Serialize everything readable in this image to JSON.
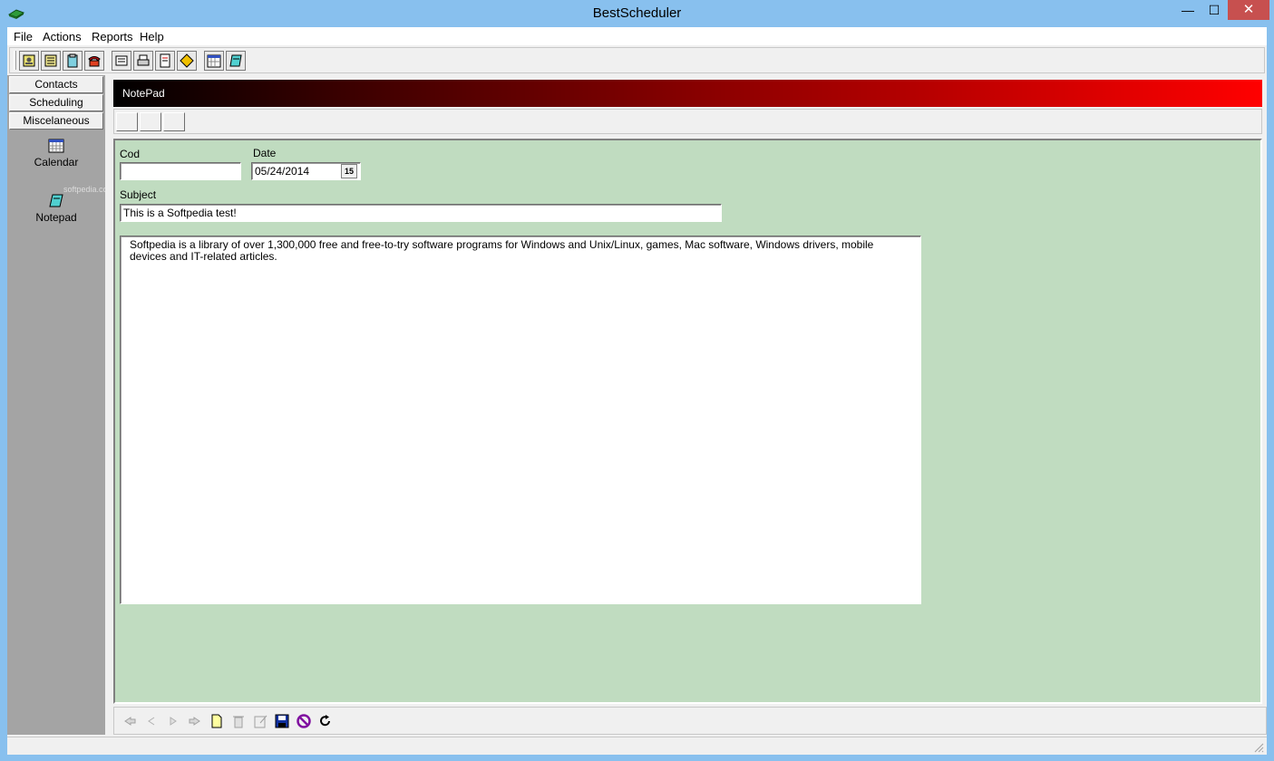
{
  "window": {
    "title": "BestScheduler",
    "minimize_glyph": "—",
    "maximize_glyph": "☐",
    "close_glyph": "✕"
  },
  "menu": {
    "items": [
      "File",
      "Actions",
      "Reports",
      "Help"
    ]
  },
  "toolbar": {
    "icons": [
      "contacts-card-icon",
      "contacts-list-icon",
      "clipboard-icon",
      "telephone-icon",
      "reminder-icon",
      "printer-icon",
      "report-icon",
      "diamond-icon",
      "calendar-icon",
      "notepad-icon"
    ]
  },
  "sidebar": {
    "groups": [
      "Contacts",
      "Scheduling",
      "Miscelaneous"
    ],
    "items": [
      {
        "label": "Calendar",
        "icon": "calendar-icon"
      },
      {
        "label": "Notepad",
        "icon": "notepad-icon"
      }
    ],
    "watermark": "softpedia.com"
  },
  "header": {
    "title": "NotePad",
    "gradient_start": "#000000",
    "gradient_end": "#ff0000"
  },
  "form": {
    "cod_label": "Cod",
    "cod_value": "",
    "date_label": "Date",
    "date_value": "05/24/2014",
    "date_button": "15",
    "subject_label": "Subject",
    "subject_value": "This is a Softpedia test!",
    "memo_text": "Softpedia is a library of over 1,300,000 free and free-to-try software programs for Windows and Unix/Linux, games, Mac software, Windows drivers, mobile devices and IT-related articles.",
    "background_color": "#c0dcc0"
  },
  "navigator": {
    "buttons": [
      "first-icon",
      "prior-icon",
      "next-icon",
      "last-icon",
      "new-icon",
      "delete-icon",
      "edit-icon",
      "save-icon",
      "cancel-icon",
      "refresh-icon"
    ]
  }
}
